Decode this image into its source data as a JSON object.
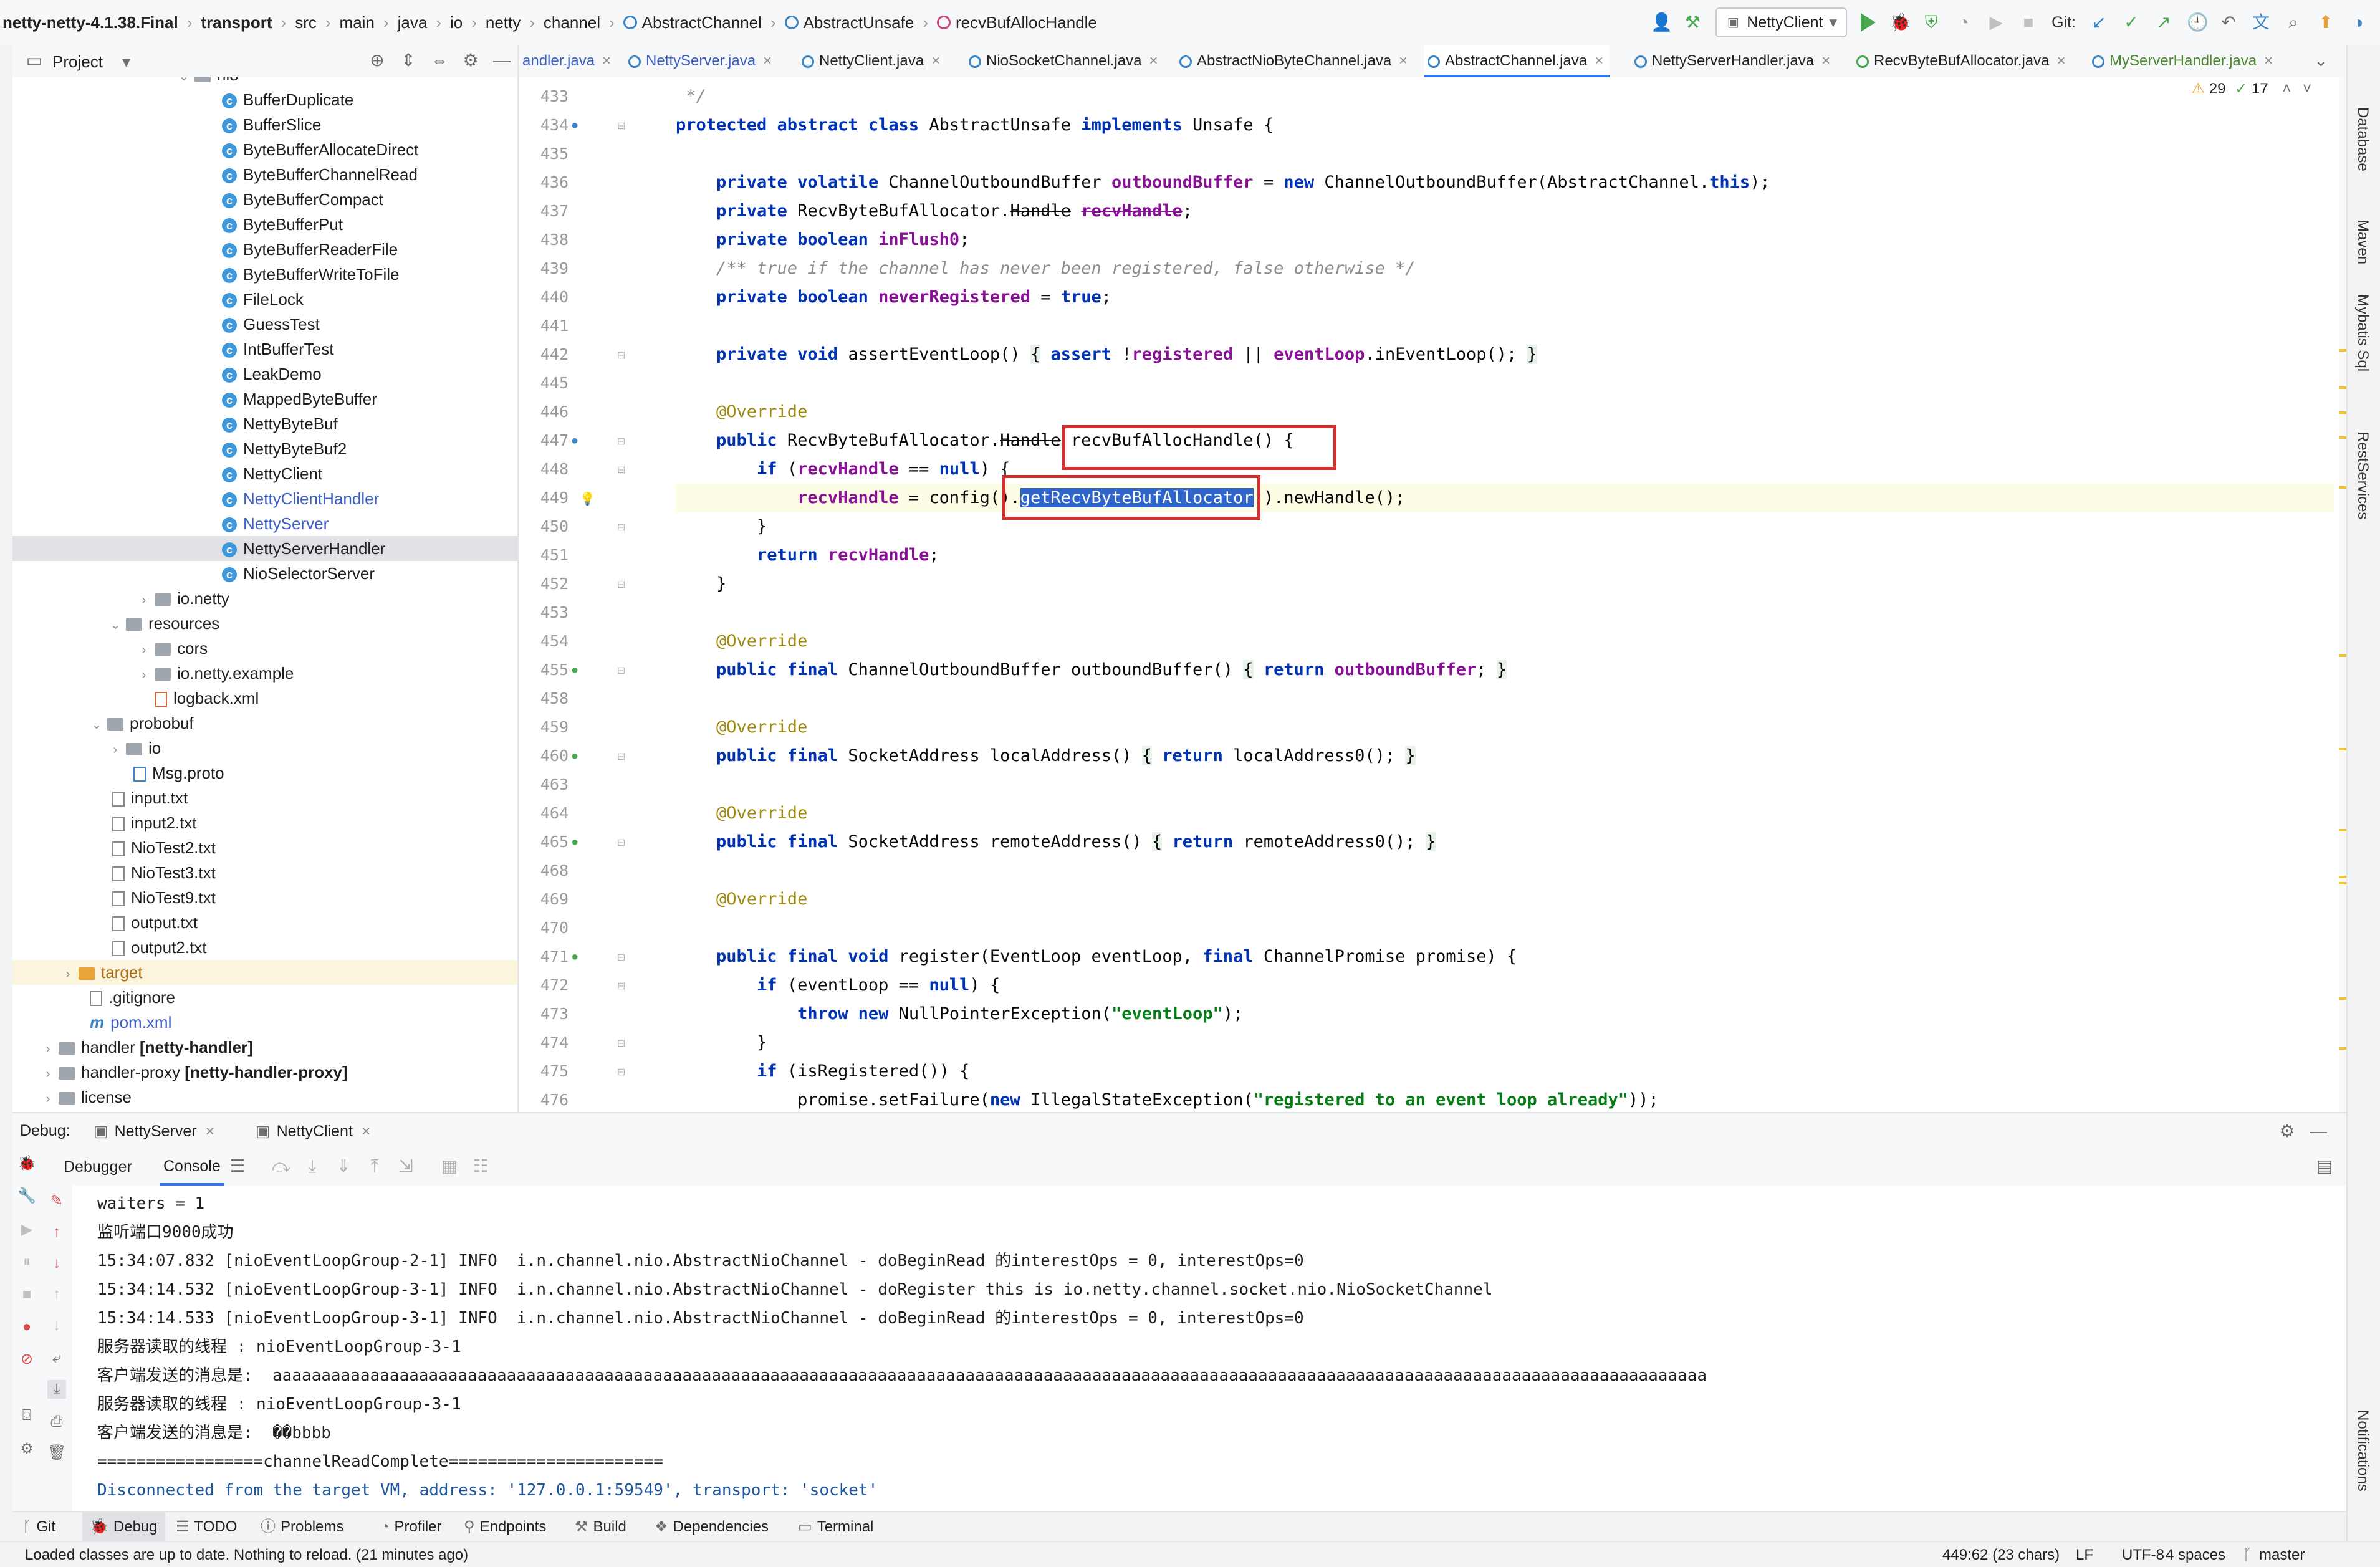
{
  "breadcrumbs": [
    "netty-netty-4.1.38.Final",
    "transport",
    "src",
    "main",
    "java",
    "io",
    "netty",
    "channel",
    "AbstractChannel",
    "AbstractUnsafe",
    "recvBufAllocHandle"
  ],
  "toolbar": {
    "run_config": "NettyClient",
    "git_label": "Git:"
  },
  "project_panel": {
    "title": "Project",
    "tree": [
      {
        "label": "nio"
      },
      {
        "label": "BufferDuplicate"
      },
      {
        "label": "BufferSlice"
      },
      {
        "label": "ByteBufferAllocateDirect"
      },
      {
        "label": "ByteBufferChannelRead"
      },
      {
        "label": "ByteBufferCompact"
      },
      {
        "label": "ByteBufferPut"
      },
      {
        "label": "ByteBufferReaderFile"
      },
      {
        "label": "ByteBufferWriteToFile"
      },
      {
        "label": "FileLock"
      },
      {
        "label": "GuessTest"
      },
      {
        "label": "IntBufferTest"
      },
      {
        "label": "LeakDemo"
      },
      {
        "label": "MappedByteBuffer"
      },
      {
        "label": "NettyByteBuf"
      },
      {
        "label": "NettyByteBuf2"
      },
      {
        "label": "NettyClient"
      },
      {
        "label": "NettyClientHandler"
      },
      {
        "label": "NettyServer"
      },
      {
        "label": "NettyServerHandler"
      },
      {
        "label": "NioSelectorServer"
      },
      {
        "label": "io.netty"
      },
      {
        "label": "resources"
      },
      {
        "label": "cors"
      },
      {
        "label": "io.netty.example"
      },
      {
        "label": "logback.xml"
      },
      {
        "label": "probobuf"
      },
      {
        "label": "io"
      },
      {
        "label": "Msg.proto"
      },
      {
        "label": "input.txt"
      },
      {
        "label": "input2.txt"
      },
      {
        "label": "NioTest2.txt"
      },
      {
        "label": "NioTest3.txt"
      },
      {
        "label": "NioTest9.txt"
      },
      {
        "label": "output.txt"
      },
      {
        "label": "output2.txt"
      },
      {
        "label": "target"
      },
      {
        "label": ".gitignore"
      },
      {
        "label": "pom.xml"
      },
      {
        "label": "handler",
        "module": "[netty-handler]"
      },
      {
        "label": "handler-proxy",
        "module": "[netty-handler-proxy]"
      },
      {
        "label": "license"
      }
    ]
  },
  "editor": {
    "tabs": [
      "andler.java",
      "NettyServer.java",
      "NettyClient.java",
      "NioSocketChannel.java",
      "AbstractNioByteChannel.java",
      "AbstractChannel.java",
      "NettyServerHandler.java",
      "RecvByteBufAllocator.java",
      "MyServerHandler.java"
    ],
    "inspections": {
      "warnings": "29",
      "checks": "17"
    },
    "line_numbers": [
      "433",
      "434",
      "435",
      "436",
      "437",
      "438",
      "439",
      "440",
      "441",
      "442",
      "445",
      "446",
      "447",
      "448",
      "449",
      "450",
      "451",
      "452",
      "453",
      "454",
      "455",
      "458",
      "459",
      "460",
      "463",
      "464",
      "465",
      "468",
      "469",
      "470",
      "471",
      "472",
      "473",
      "474",
      "475",
      "476"
    ],
    "code": {
      "l433": " */",
      "l434a": "protected abstract class",
      "l434b": " AbstractUnsafe ",
      "l434c": "implements",
      "l434d": " Unsafe {",
      "l436a": "    private volatile",
      "l436b": " ChannelOutboundBuffer ",
      "l436c": "outboundBuffer",
      "l436d": " = ",
      "l436e": "new",
      "l436f": " ChannelOutboundBuffer(AbstractChannel.",
      "l436g": "this",
      "l436h": ");",
      "l437a": "    private",
      "l437b": " RecvByteBufAllocator.",
      "l437c": "Handle",
      "l437d": " ",
      "l437e": "recvHandle",
      "l437f": ";",
      "l438a": "    private boolean",
      "l438b": " ",
      "l438c": "inFlush0",
      "l438d": ";",
      "l439": "    /** true if the channel has never been registered, false otherwise */",
      "l440a": "    private boolean",
      "l440b": " ",
      "l440c": "neverRegistered",
      "l440d": " = ",
      "l440e": "true",
      "l440f": ";",
      "l442a": "    private void",
      "l442b": " assertEventLoop() ",
      "l442c": "{",
      "l442d": " assert",
      "l442e": " !",
      "l442f": "registered",
      "l442g": " || ",
      "l442h": "eventLoop",
      "l442i": ".inEventLoop(); ",
      "l442j": "}",
      "l446": "    @Override",
      "l447a": "    public",
      "l447b": " RecvByteBufAllocator.",
      "l447c": "Handle",
      "l447d": " recvBufAllocHandle() {",
      "l448a": "        if",
      "l448b": " (",
      "l448c": "recvHandle",
      "l448d": " == ",
      "l448e": "null",
      "l448f": ") {",
      "l449a": "            ",
      "l449b": "recvHandle",
      "l449c": " = config().",
      "l449d": "getRecvByteBufAllocator",
      "l449e": "().newHandle();",
      "l450": "        }",
      "l451a": "        return",
      "l451b": " ",
      "l451c": "recvHandle",
      "l451d": ";",
      "l452": "    }",
      "l454": "    @Override",
      "l455a": "    public final",
      "l455b": " ChannelOutboundBuffer outboundBuffer() ",
      "l455c": "{",
      "l455d": " return",
      "l455e": " ",
      "l455f": "outboundBuffer",
      "l455g": "; ",
      "l455h": "}",
      "l459": "    @Override",
      "l460a": "    public final",
      "l460b": " SocketAddress localAddress() ",
      "l460c": "{",
      "l460d": " return",
      "l460e": " localAddress0(); ",
      "l460f": "}",
      "l464": "    @Override",
      "l465a": "    public final",
      "l465b": " SocketAddress remoteAddress() ",
      "l465c": "{",
      "l465d": " return",
      "l465e": " remoteAddress0(); ",
      "l465f": "}",
      "l469": "    @Override",
      "l471a": "    public final void",
      "l471b": " register(EventLoop eventLoop, ",
      "l471c": "final",
      "l471d": " ChannelPromise promise) {",
      "l472a": "        if",
      "l472b": " (eventLoop == ",
      "l472c": "null",
      "l472d": ") {",
      "l473a": "            throw new",
      "l473b": " NullPointerException(",
      "l473c": "\"eventLoop\"",
      "l473d": ");",
      "l474": "        }",
      "l475a": "        if",
      "l475b": " (isRegistered()) {",
      "l476a": "            promise.setFailure(",
      "l476b": "new",
      "l476c": " IllegalStateException(",
      "l476d": "\"registered to an event loop already\"",
      "l476e": "));"
    }
  },
  "debug": {
    "label": "Debug:",
    "sessions": [
      "NettyServer",
      "NettyClient"
    ],
    "tabs": [
      "Debugger",
      "Console"
    ],
    "console_lines": [
      "waiters = 1",
      "监听端口9000成功",
      "15:34:07.832 [nioEventLoopGroup-2-1] INFO  i.n.channel.nio.AbstractNioChannel - doBeginRead 的interestOps = 0, interestOps=0",
      "15:34:14.532 [nioEventLoopGroup-3-1] INFO  i.n.channel.nio.AbstractNioChannel - doRegister this is io.netty.channel.socket.nio.NioSocketChannel",
      "15:34:14.533 [nioEventLoopGroup-3-1] INFO  i.n.channel.nio.AbstractNioChannel - doBeginRead 的interestOps = 0, interestOps=0",
      "服务器读取的线程 : nioEventLoopGroup-3-1",
      "客户端发送的消息是:  aaaaaaaaaaaaaaaaaaaaaaaaaaaaaaaaaaaaaaaaaaaaaaaaaaaaaaaaaaaaaaaaaaaaaaaaaaaaaaaaaaaaaaaaaaaaaaaaaaaaaaaaaaaaaaaaaaaaaaaaaaaaaaaaaaaaaaaaaaaaaaaaaaa",
      "服务器读取的线程 : nioEventLoopGroup-3-1",
      "客户端发送的消息是:  ��bbbb",
      "=================channelReadComplete======================",
      "Disconnected from the target VM, address: '127.0.0.1:59549', transport: 'socket'"
    ]
  },
  "tool_windows": [
    "Git",
    "Debug",
    "TODO",
    "Problems",
    "Profiler",
    "Endpoints",
    "Build",
    "Dependencies",
    "Terminal"
  ],
  "right_tools": [
    "Database",
    "Maven",
    "Mybatis Sql",
    "RestServices",
    "Notifications"
  ],
  "status": {
    "message": "Loaded classes are up to date. Nothing to reload. (21 minutes ago)",
    "position": "449:62 (23 chars)",
    "line_sep": "LF",
    "encoding": "UTF-8",
    "indent": "4 spaces",
    "branch": "master"
  },
  "colors": {
    "keyword": "#0033b3",
    "field": "#871094",
    "string": "#067d17",
    "annotation": "#9e880d",
    "highlight_box": "#d32f2f",
    "selection": "#2f65ca"
  }
}
